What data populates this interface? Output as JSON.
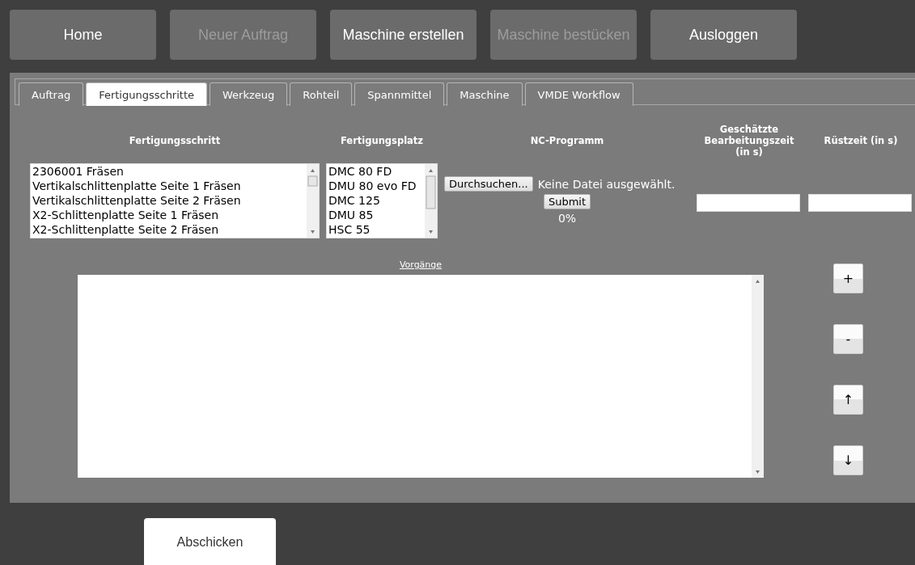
{
  "nav": [
    {
      "label": "Home",
      "disabled": false
    },
    {
      "label": "Neuer Auftrag",
      "disabled": true
    },
    {
      "label": "Maschine erstellen",
      "disabled": false
    },
    {
      "label": "Maschine bestücken",
      "disabled": true
    },
    {
      "label": "Ausloggen",
      "disabled": false
    }
  ],
  "tabs": [
    {
      "label": "Auftrag",
      "selected": false
    },
    {
      "label": "Fertigungsschritte",
      "selected": true
    },
    {
      "label": "Werkzeug",
      "selected": false
    },
    {
      "label": "Rohteil",
      "selected": false
    },
    {
      "label": "Spannmittel",
      "selected": false
    },
    {
      "label": "Maschine",
      "selected": false
    },
    {
      "label": "VMDE Workflow",
      "selected": false
    }
  ],
  "columns": {
    "step": "Fertigungsschritt",
    "place": "Fertigungsplatz",
    "nc": "NC-Programm",
    "time": "Geschätzte Bearbeitungszeit (in s)",
    "setup": "Rüstzeit (in s)"
  },
  "steps": [
    {
      "label": "2306001 Fräsen",
      "selected": false
    },
    {
      "label": "Vertikalschlittenplatte Seite 1 Fräsen",
      "selected": false
    },
    {
      "label": "Vertikalschlittenplatte Seite 2 Fräsen",
      "selected": false
    },
    {
      "label": "X2-Schlittenplatte Seite 1 Fräsen",
      "selected": false
    },
    {
      "label": "X2-Schlittenplatte Seite 2 Fräsen",
      "selected": false
    }
  ],
  "places": [
    {
      "label": "DMC 80 FD",
      "selected": false
    },
    {
      "label": "DMU 80 evo FD",
      "selected": false
    },
    {
      "label": "DMC 125",
      "selected": false
    },
    {
      "label": "DMU 85",
      "selected": false
    },
    {
      "label": "HSC 55",
      "selected": false
    }
  ],
  "nc": {
    "browse": "Durchsuchen...",
    "file": "Keine Datei ausgewählt.",
    "submit": "Submit",
    "progress": "0%"
  },
  "operations": {
    "title": "Vorgänge",
    "buttons": [
      "+",
      "-",
      "↑",
      "↓"
    ]
  },
  "send": "Abschicken"
}
